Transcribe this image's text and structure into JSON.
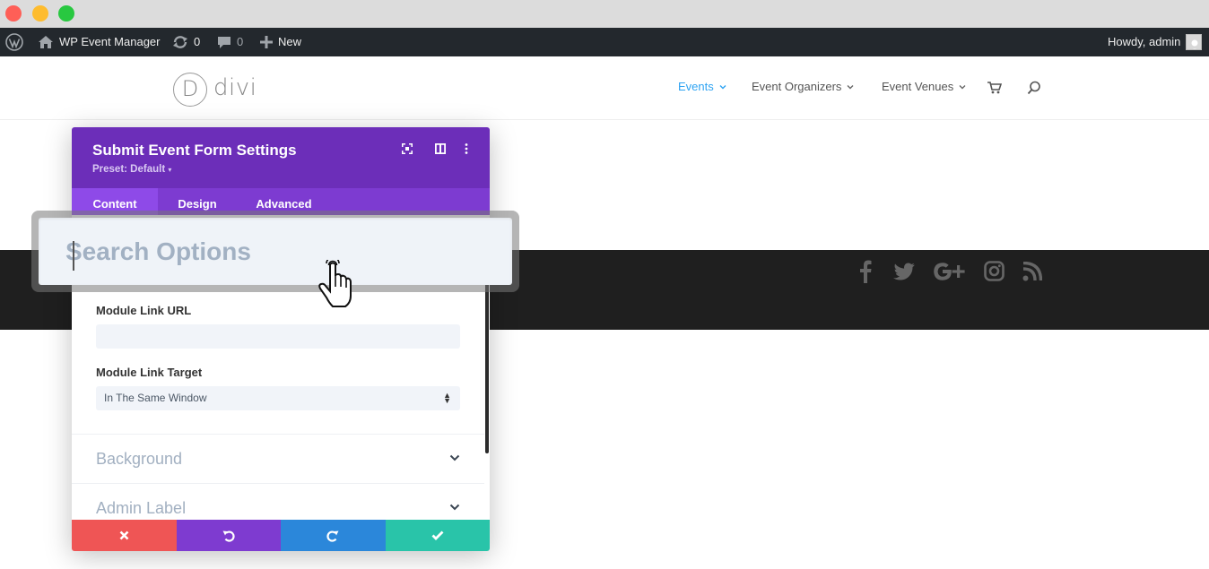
{
  "adminbar": {
    "site_name": "WP Event Manager",
    "updates_count": "0",
    "comments_count": "0",
    "new_label": "New",
    "greeting": "Howdy, admin"
  },
  "site": {
    "logo_letter": "D",
    "logo_text": "divi",
    "nav": [
      {
        "label": "Events",
        "active": true
      },
      {
        "label": "Event Organizers",
        "active": false
      },
      {
        "label": "Event Venues",
        "active": false
      }
    ],
    "accent": "#2ea3f2"
  },
  "modal": {
    "title": "Submit Event Form Settings",
    "preset": "Preset: Default",
    "tabs": [
      "Content",
      "Design",
      "Advanced"
    ],
    "search_placeholder": "Search Options",
    "fields": {
      "link_url_label": "Module Link URL",
      "link_url_value": "",
      "link_target_label": "Module Link Target",
      "link_target_value": "In The Same Window"
    },
    "sections": [
      "Background",
      "Admin Label"
    ],
    "colors": {
      "header": "#6c2eb9",
      "tabs": "#7d3bd1",
      "cancel": "#ef5555",
      "undo": "#7e3bd0",
      "redo": "#2b87da",
      "save": "#29c4a9"
    }
  }
}
